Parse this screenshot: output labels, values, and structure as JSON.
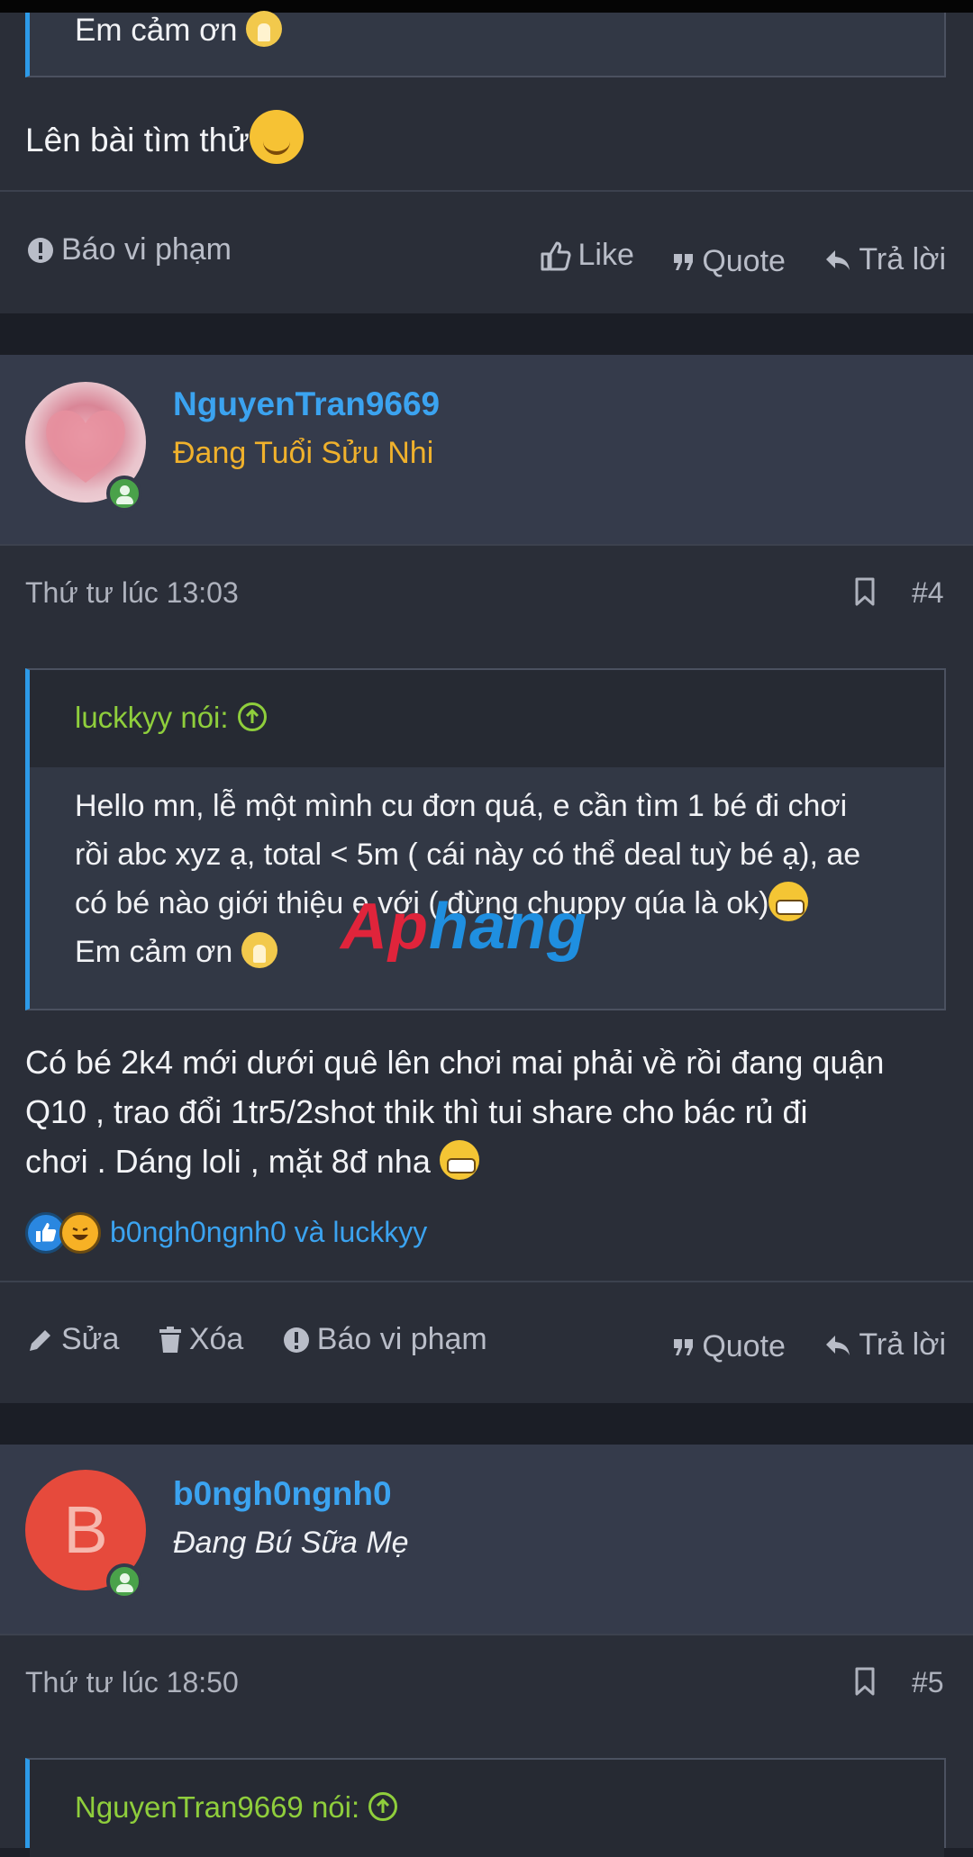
{
  "post3": {
    "quote_tail_text": "Em cảm ơn",
    "body_text": "Lên bài tìm thử",
    "actions": {
      "report": "Báo vi phạm",
      "like": "Like",
      "quote": "Quote",
      "reply": "Trả lời"
    }
  },
  "post4": {
    "username": "NguyenTran9669",
    "user_title": "Đang Tuổi Sửu Nhi",
    "date": "Thứ tư lúc 13:03",
    "post_number": "#4",
    "quote": {
      "author": "luckkyy nói:",
      "lines": [
        "Hello mn, lễ một mình cu đơn quá, e cần tìm 1 bé đi chơi",
        "rồi abc xyz ạ, total < 5m ( cái này có thể deal tuỳ bé ạ), ae",
        "có bé nào giới thiệu e với ( đừng chuppy qúa là ok)",
        "Em cảm ơn"
      ]
    },
    "body_lines": [
      "Có bé 2k4 mới dưới quê lên chơi mai phải về rồi đang quận",
      "Q10 , trao đổi 1tr5/2shot thik thì tui share cho bác rủ đi",
      "chơi . Dáng loli , mặt 8đ nha"
    ],
    "reactions": {
      "icons": [
        "like-icon",
        "haha-icon"
      ],
      "names": "b0ngh0ngnh0 và luckkyy"
    },
    "actions": {
      "edit": "Sửa",
      "delete": "Xóa",
      "report": "Báo vi phạm",
      "quote": "Quote",
      "reply": "Trả lời"
    }
  },
  "post5": {
    "username": "b0ngh0ngnh0",
    "avatar_letter": "B",
    "user_title": "Đang Bú Sữa Mẹ",
    "date": "Thứ tư lúc 18:50",
    "post_number": "#5",
    "quote_author": "NguyenTran9669 nói:"
  },
  "watermark": {
    "part1": "Ap",
    "part2": "hang"
  },
  "colors": {
    "background": "#2a2e38",
    "header_bg": "#353b4b",
    "username": "#3ba3f0",
    "title_gold": "#f0b12c",
    "quote_author": "#8fce3c",
    "quote_border": "#2d9ae8",
    "avatar_b": "#e64a3c"
  }
}
